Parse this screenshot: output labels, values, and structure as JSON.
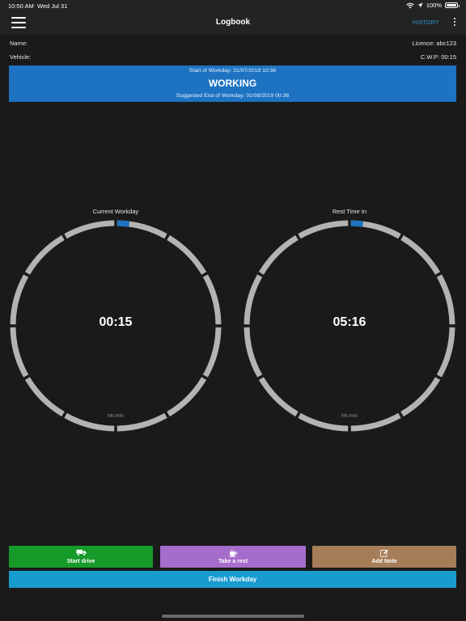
{
  "status_bar": {
    "time": "10:50 AM",
    "date": "Wed Jul 31",
    "battery": "100%"
  },
  "nav": {
    "title": "Logbook",
    "history_label": "HISTORY"
  },
  "info": {
    "name_label": "Name:",
    "licence": "Licence: abc123",
    "vehicle_label": "Vehicle:",
    "cwp": "C.W.P: 00:15"
  },
  "banner": {
    "start": "Start of Workday: 31/07/2019 10:36",
    "status": "WORKING",
    "suggested_end": "Suggested End of Workday: 01/08/2019 00:36",
    "color": "#1d73c2"
  },
  "gauges": [
    {
      "label": "Current Workday",
      "value": "00:15",
      "unit": "hh:mm",
      "progress_fraction": 0.021,
      "track_color": "#b3b3b3",
      "fill_color": "#1d73c2"
    },
    {
      "label": "Rest Time In",
      "value": "05:16",
      "unit": "hh:mm",
      "progress_fraction": 0.021,
      "track_color": "#b3b3b3",
      "fill_color": "#1d73c2"
    }
  ],
  "actions": {
    "start_drive": "Start drive",
    "take_rest": "Take a rest",
    "add_note": "Add Note",
    "finish_workday": "Finish Workday"
  },
  "icons": {
    "menu": "hamburger-icon",
    "more": "more-vertical-icon",
    "drive": "truck-icon",
    "rest": "coffee-cup-icon",
    "note": "edit-note-icon",
    "wifi": "wifi-icon",
    "location": "location-arrow-icon",
    "battery": "battery-icon"
  }
}
